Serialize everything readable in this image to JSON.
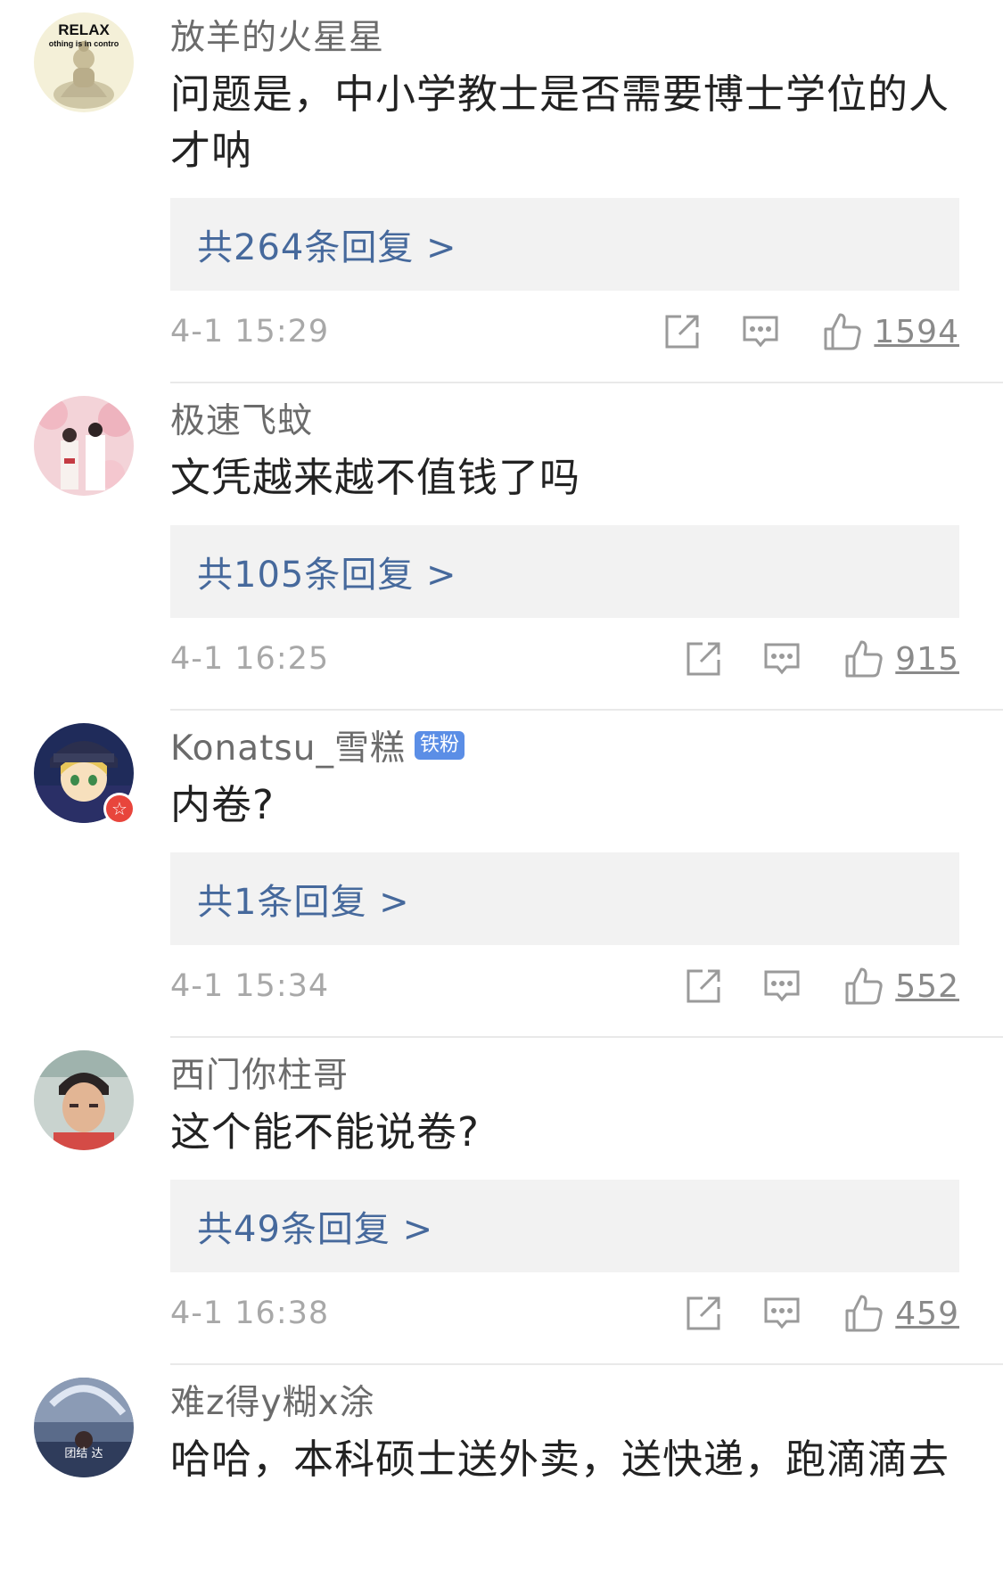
{
  "comments": [
    {
      "username": "放羊的火星星",
      "text": "问题是，中小学教士是否需要博士学位的人才呐",
      "reply_label": "共264条回复 >",
      "time": "4-1 15:29",
      "likes": "1594",
      "avatar_text_top": "RELAX",
      "avatar_text_sub": "othing is in contro"
    },
    {
      "username": "极速飞蚊",
      "text": "文凭越来越不值钱了吗",
      "reply_label": "共105条回复 >",
      "time": "4-1 16:25",
      "likes": "915"
    },
    {
      "username": "Konatsu_雪糕",
      "badge": "铁粉",
      "text": "内卷?",
      "reply_label": "共1条回复 >",
      "time": "4-1 15:34",
      "likes": "552"
    },
    {
      "username": "西门你柱哥",
      "text": "这个能不能说卷?",
      "reply_label": "共49条回复 >",
      "time": "4-1 16:38",
      "likes": "459"
    },
    {
      "username": "难z得y糊x涂",
      "text": "哈哈，本科硕士送外卖，送快递，跑滴滴去",
      "avatar_text": "团结 达"
    }
  ],
  "colors": {
    "link_blue": "#46699c",
    "reply_bg": "#f2f2f2",
    "muted": "#a8a8a8",
    "badge_blue": "#5b8ee6"
  },
  "icons": [
    "share-icon",
    "comment-icon",
    "thumbs-up-icon"
  ]
}
